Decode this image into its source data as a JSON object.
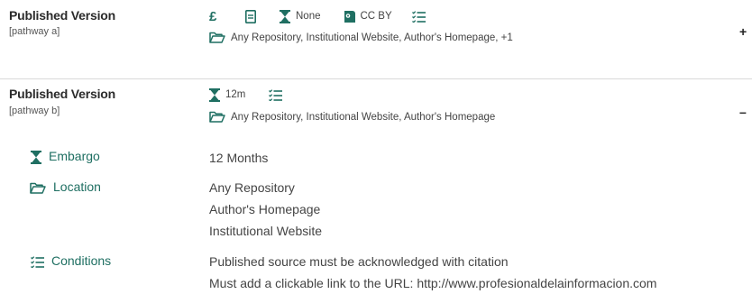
{
  "pathways": [
    {
      "title": "Published Version",
      "subtitle": "[pathway a]",
      "fee": "£",
      "embargo": "None",
      "license": "CC BY",
      "locations": "Any Repository, Institutional Website, Author's Homepage, +1",
      "toggle": "+"
    },
    {
      "title": "Published Version",
      "subtitle": "[pathway b]",
      "embargo": "12m",
      "locations": "Any Repository, Institutional Website, Author's Homepage",
      "toggle": "–"
    }
  ],
  "details": {
    "embargo_label": "Embargo",
    "embargo_value": "12 Months",
    "location_label": "Location",
    "location_values": [
      "Any Repository",
      "Author's Homepage",
      "Institutional Website"
    ],
    "conditions_label": "Conditions",
    "conditions_values": [
      "Published source must be acknowledged with citation",
      "Must add a clickable link to the URL: http://www.profesionaldelainformacion.com"
    ]
  },
  "colors": {
    "accent": "#1f6f62",
    "divider": "#d9d9d9"
  }
}
